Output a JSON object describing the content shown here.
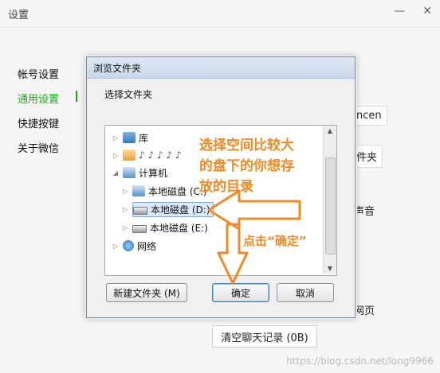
{
  "settings": {
    "title": "设置",
    "controls": [
      "—",
      "✕"
    ],
    "sidebar": [
      {
        "label": "帐号设置",
        "active": false
      },
      {
        "label": "通用设置",
        "active": true
      },
      {
        "label": "快捷按键",
        "active": false
      },
      {
        "label": "关于微信",
        "active": false
      }
    ],
    "right_path_fragment": "ncen",
    "right_btn_fragment": "件夹",
    "right_sound_fragment": "声音",
    "right_web_fragment": "网页",
    "clear_button": "清空聊天记录 (0B)"
  },
  "dialog": {
    "title": "浏览文件夹",
    "prompt": "选择文件夹",
    "tree": [
      {
        "label": "库",
        "icon": "library-icon",
        "expander": "▷"
      },
      {
        "label": "♪ ♪ ♪ ♪ ♪",
        "icon": "user-folder-icon",
        "expander": "▷"
      },
      {
        "label": "计算机",
        "icon": "computer-icon",
        "expander": "◢"
      },
      {
        "label": "本地磁盘 (C:)",
        "icon": "drive-c-icon",
        "expander": "▷"
      },
      {
        "label": "本地磁盘 (D:)",
        "icon": "drive-icon",
        "expander": "▷"
      },
      {
        "label": "本地磁盘 (E:)",
        "icon": "drive-icon",
        "expander": "▷"
      },
      {
        "label": "网络",
        "icon": "network-icon",
        "expander": "▷"
      }
    ],
    "buttons": {
      "new_folder": "新建文件夹 (M)",
      "ok": "确定",
      "cancel": "取消"
    }
  },
  "annotations": {
    "line1": "选择空间比较大",
    "line2": "的盘下的你想存",
    "line3": "放的目录",
    "click_ok": "点击“确定”",
    "color": "#f08a24"
  },
  "watermark": "https://blog.csdn.net/long9966"
}
